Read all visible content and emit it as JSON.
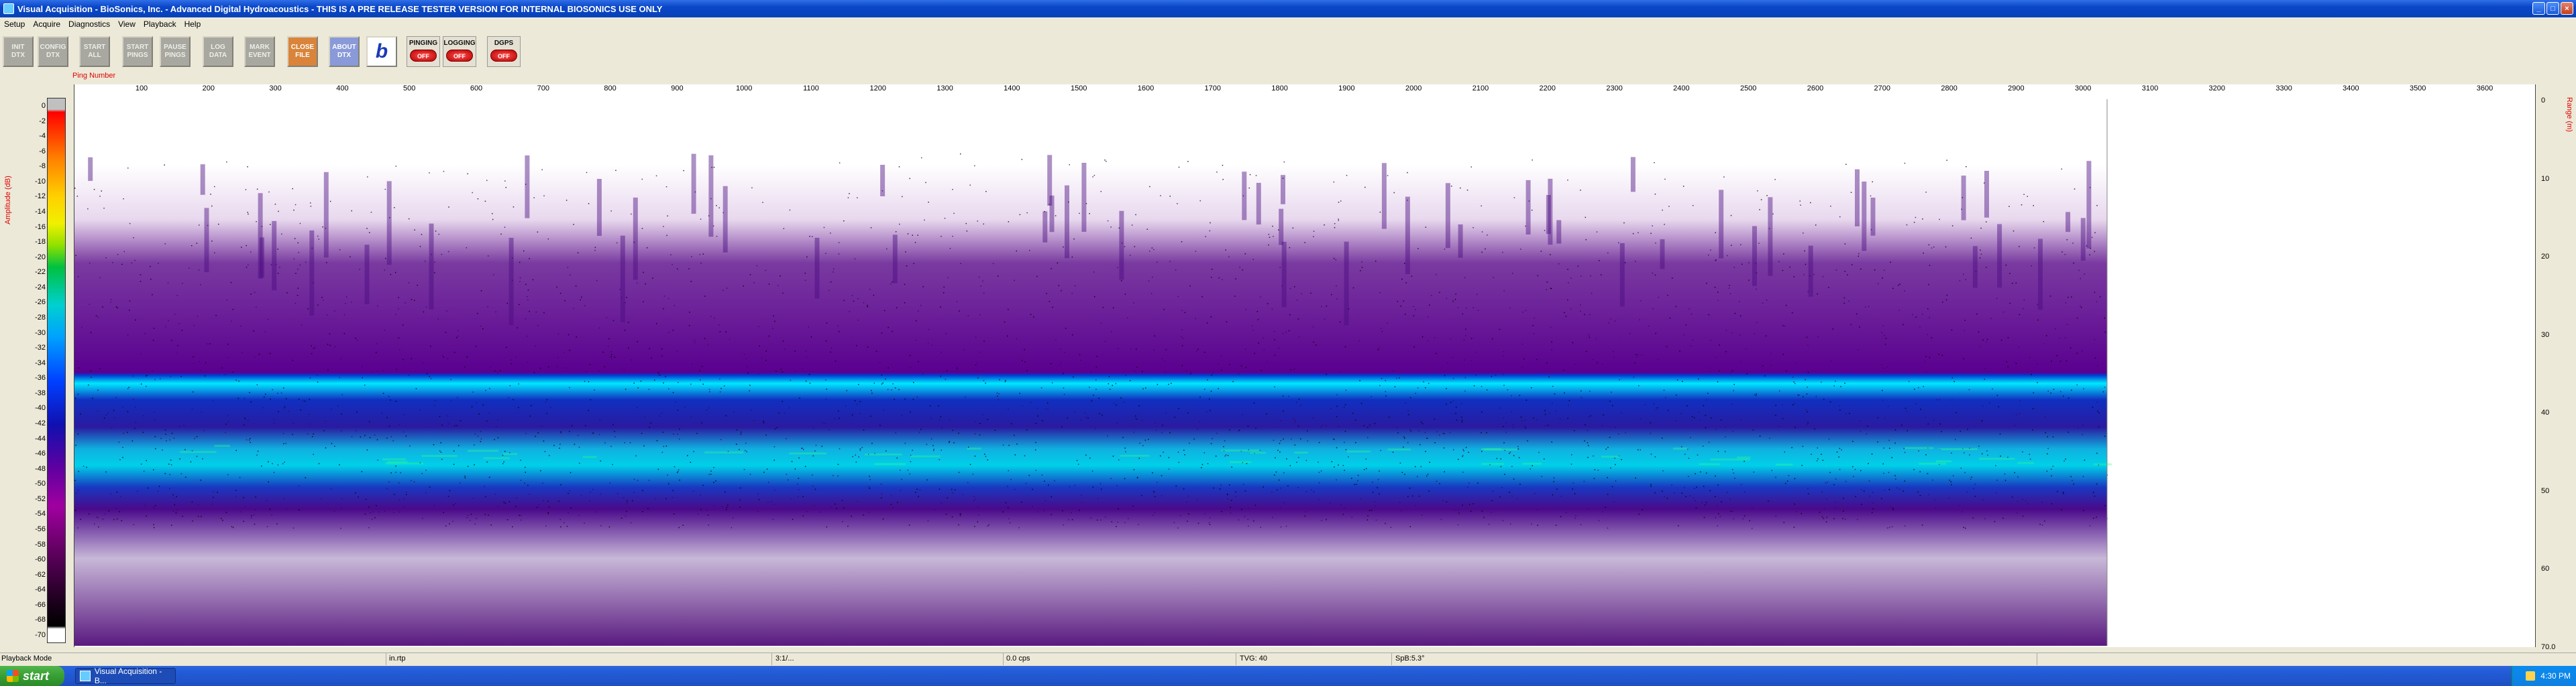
{
  "window": {
    "title": "Visual Acquisition  -  BioSonics, Inc.  -  Advanced Digital Hydroacoustics  -  THIS IS A PRE RELEASE TESTER VERSION FOR INTERNAL BIOSONICS USE ONLY",
    "buttons": {
      "minimize": "_",
      "maximize": "□",
      "close": "×"
    }
  },
  "menu": [
    "Setup",
    "Acquire",
    "Diagnostics",
    "View",
    "Playback",
    "Help"
  ],
  "toolbar": {
    "buttons": [
      "INIT\nDTX",
      "CONFIG\nDTX",
      "START\nALL",
      "START\nPINGS",
      "PAUSE\nPINGS",
      "LOG\nDATA",
      "MARK\nEVENT",
      "CLOSE\nFILE",
      "ABOUT\nDTX"
    ],
    "logo": "b",
    "indicators": [
      {
        "label": "PINGING",
        "state": "OFF"
      },
      {
        "label": "LOGGING",
        "state": "OFF"
      },
      {
        "label": "DGPS",
        "state": "OFF"
      }
    ]
  },
  "echogram": {
    "ping_axis_label": "Ping Number",
    "ping_ticks": [
      "100",
      "200",
      "300",
      "400",
      "500",
      "600",
      "700",
      "800",
      "900",
      "1000",
      "1100",
      "1200",
      "1300",
      "1400",
      "1500",
      "1600",
      "1700",
      "1800",
      "1900",
      "2000",
      "2100",
      "2200",
      "2300",
      "2400",
      "2500",
      "2600",
      "2700",
      "2800",
      "2900",
      "3000",
      "3100",
      "3200",
      "3300",
      "3400",
      "3500",
      "3600"
    ],
    "amplitude_label": "Amplitude (dB)",
    "amplitude_ticks": [
      "0",
      "-2",
      "-4",
      "-6",
      "-8",
      "-10",
      "-12",
      "-14",
      "-16",
      "-18",
      "-20",
      "-22",
      "-24",
      "-26",
      "-28",
      "-30",
      "-32",
      "-34",
      "-36",
      "-38",
      "-40",
      "-42",
      "-44",
      "-46",
      "-48",
      "-50",
      "-52",
      "-54",
      "-56",
      "-58",
      "-60",
      "-62",
      "-64",
      "-66",
      "-68",
      "-70"
    ],
    "range_label": "Range (m)",
    "depth_ticks": [
      "0",
      "10",
      "20",
      "30",
      "40",
      "50",
      "60",
      "70.0"
    ],
    "colors": {
      "band": "#10b0e0",
      "band_core": "#00e8ff",
      "noise": "#5a0090",
      "speck": "#000000"
    }
  },
  "status": {
    "mode": "Playback Mode",
    "file": "in.rtp",
    "time": "3:1/...",
    "rate": "0.0 cps",
    "tvg": "TVG: 40",
    "sp": "SpB:5.3°"
  },
  "taskbar": {
    "start": "start",
    "task": "Visual Acquisition - B...",
    "clock": "4:30 PM"
  }
}
